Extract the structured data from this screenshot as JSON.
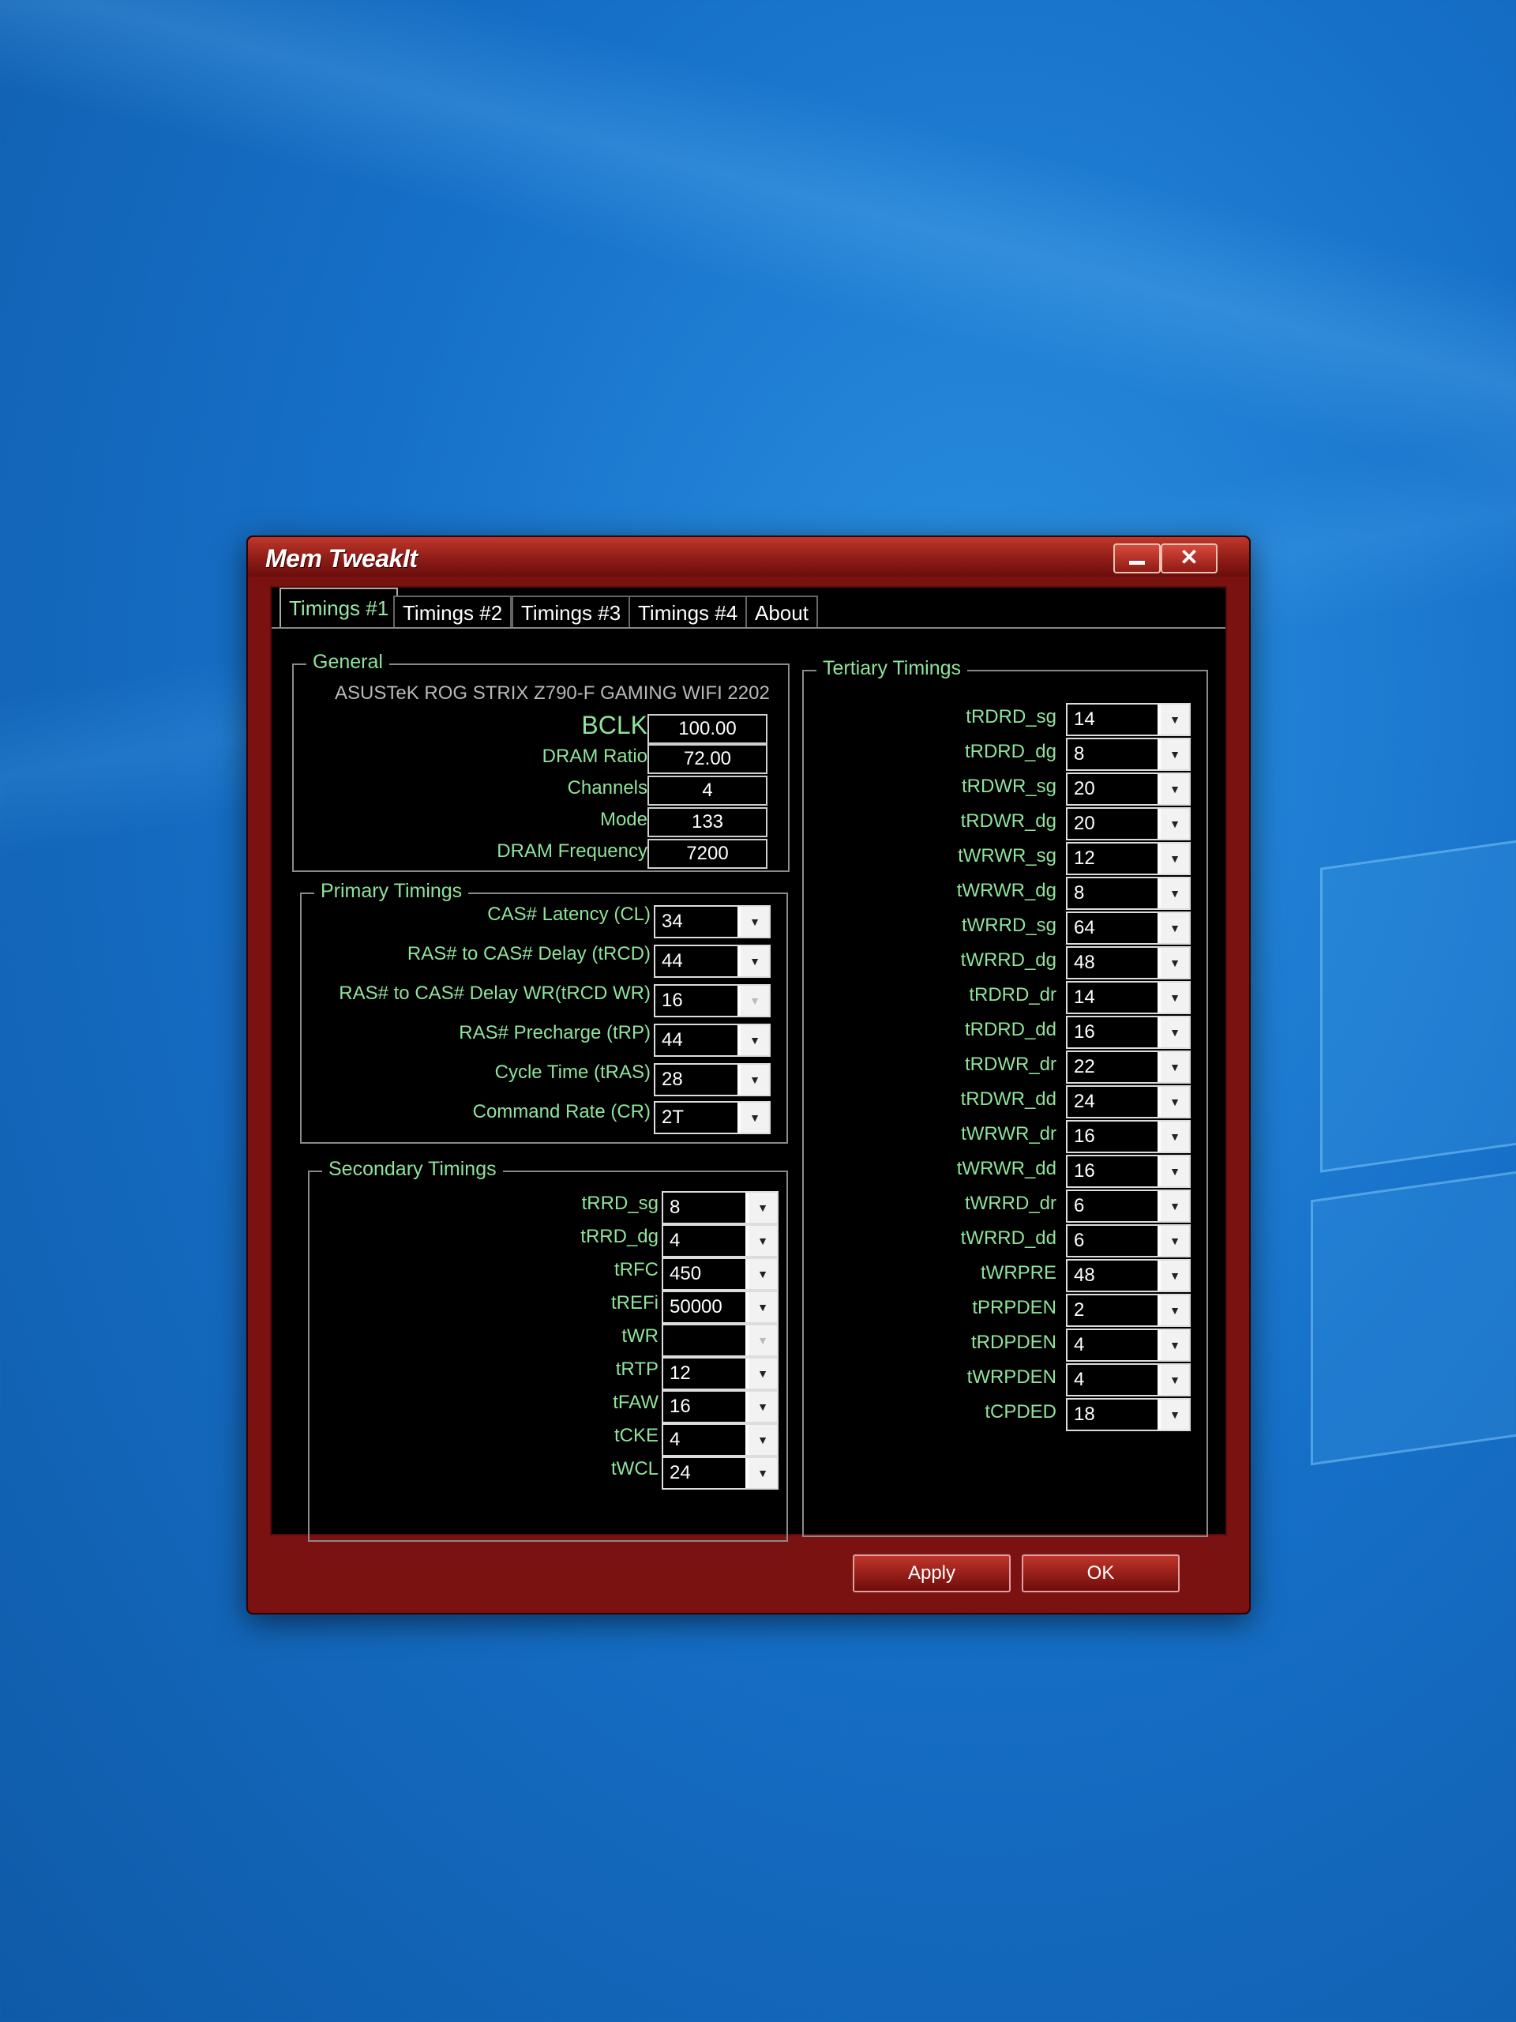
{
  "window": {
    "title": "Mem TweakIt",
    "minimize_label": "",
    "close_label": "✕"
  },
  "tabs": [
    {
      "label": "Timings #1",
      "active": true
    },
    {
      "label": "Timings #2",
      "active": false
    },
    {
      "label": "Timings #3",
      "active": false
    },
    {
      "label": "Timings #4",
      "active": false
    },
    {
      "label": "About",
      "active": false
    }
  ],
  "general": {
    "title": "General",
    "board": "ASUSTeK ROG STRIX Z790-F GAMING WIFI 2202",
    "fields": [
      {
        "label": "BCLK",
        "value": "100.00"
      },
      {
        "label": "DRAM Ratio",
        "value": "72.00"
      },
      {
        "label": "Channels",
        "value": "4"
      },
      {
        "label": "Mode",
        "value": "133"
      },
      {
        "label": "DRAM Frequency",
        "value": "7200"
      }
    ]
  },
  "primary": {
    "title": "Primary Timings",
    "fields": [
      {
        "label": "CAS# Latency (CL)",
        "value": "34"
      },
      {
        "label": "RAS# to CAS# Delay (tRCD)",
        "value": "44"
      },
      {
        "label": "RAS# to CAS# Delay WR(tRCD WR)",
        "value": "16"
      },
      {
        "label": "RAS# Precharge (tRP)",
        "value": "44"
      },
      {
        "label": "Cycle Time (tRAS)",
        "value": "28"
      },
      {
        "label": "Command Rate (CR)",
        "value": "2T"
      }
    ]
  },
  "secondary": {
    "title": "Secondary Timings",
    "fields": [
      {
        "label": "tRRD_sg",
        "value": "8"
      },
      {
        "label": "tRRD_dg",
        "value": "4"
      },
      {
        "label": "tRFC",
        "value": "450"
      },
      {
        "label": "tREFi",
        "value": "50000"
      },
      {
        "label": "tWR",
        "value": ""
      },
      {
        "label": "tRTP",
        "value": "12"
      },
      {
        "label": "tFAW",
        "value": "16"
      },
      {
        "label": "tCKE",
        "value": "4"
      },
      {
        "label": "tWCL",
        "value": "24"
      }
    ]
  },
  "tertiary": {
    "title": "Tertiary Timings",
    "fields": [
      {
        "label": "tRDRD_sg",
        "value": "14"
      },
      {
        "label": "tRDRD_dg",
        "value": "8"
      },
      {
        "label": "tRDWR_sg",
        "value": "20"
      },
      {
        "label": "tRDWR_dg",
        "value": "20"
      },
      {
        "label": "tWRWR_sg",
        "value": "12"
      },
      {
        "label": "tWRWR_dg",
        "value": "8"
      },
      {
        "label": "tWRRD_sg",
        "value": "64"
      },
      {
        "label": "tWRRD_dg",
        "value": "48"
      },
      {
        "label": "tRDRD_dr",
        "value": "14"
      },
      {
        "label": "tRDRD_dd",
        "value": "16"
      },
      {
        "label": "tRDWR_dr",
        "value": "22"
      },
      {
        "label": "tRDWR_dd",
        "value": "24"
      },
      {
        "label": "tWRWR_dr",
        "value": "16"
      },
      {
        "label": "tWRWR_dd",
        "value": "16"
      },
      {
        "label": "tWRRD_dr",
        "value": "6"
      },
      {
        "label": "tWRRD_dd",
        "value": "6"
      },
      {
        "label": "tWRPRE",
        "value": "48"
      },
      {
        "label": "tPRPDEN",
        "value": "2"
      },
      {
        "label": "tRDPDEN",
        "value": "4"
      },
      {
        "label": "tWRPDEN",
        "value": "4"
      },
      {
        "label": "tCPDED",
        "value": "18"
      }
    ]
  },
  "buttons": {
    "apply": "Apply",
    "ok": "OK"
  },
  "icons": {
    "dropdown_arrow": "▼"
  },
  "colors": {
    "label_green": "#8fe39a",
    "title_red": "#c0382c"
  }
}
